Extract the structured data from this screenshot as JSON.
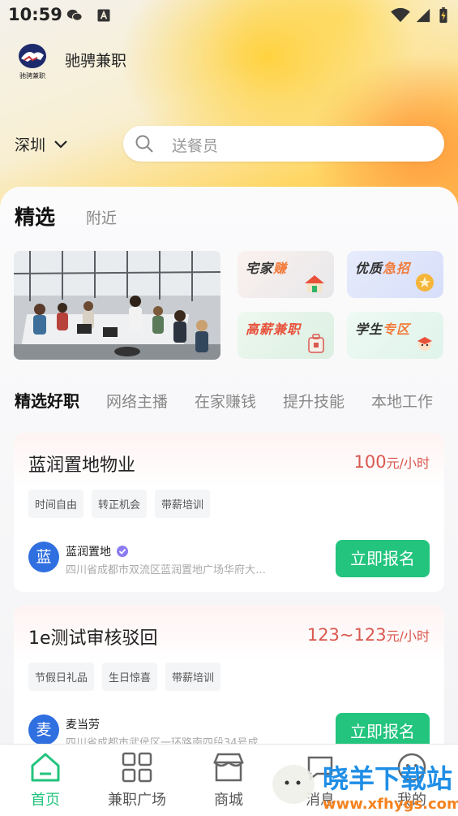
{
  "status_bar": {
    "time": "10:59"
  },
  "app": {
    "name": "驰骋兼职",
    "logo_text": "驰骋兼职"
  },
  "location": {
    "city": "深圳"
  },
  "search": {
    "placeholder": "送餐员"
  },
  "top_tabs": [
    {
      "label": "精选",
      "active": true
    },
    {
      "label": "附近",
      "active": false
    }
  ],
  "quick_tiles": [
    {
      "label_a": "宅家",
      "label_b": "赚",
      "icon": "house-icon"
    },
    {
      "label_a": "优质",
      "label_b": "急招",
      "icon": "star-coin-icon"
    },
    {
      "label_a": "高薪兼职",
      "label_b": "",
      "icon": "briefcase-icon"
    },
    {
      "label_a": "学生",
      "label_b": "专区",
      "icon": "student-icon"
    }
  ],
  "categories": [
    {
      "label": "精选好职",
      "active": true
    },
    {
      "label": "网络主播",
      "active": false
    },
    {
      "label": "在家赚钱",
      "active": false
    },
    {
      "label": "提升技能",
      "active": false
    },
    {
      "label": "本地工作",
      "active": false
    }
  ],
  "jobs": [
    {
      "title": "蓝润置地物业",
      "price": "100",
      "unit": "元/小时",
      "tags": [
        "时间自由",
        "转正机会",
        "带薪培训"
      ],
      "avatar": "蓝",
      "company": "蓝润置地",
      "address": "四川省成都市双流区蓝润置地广场华府大…",
      "apply_label": "立即报名"
    },
    {
      "title": "1e测试审核驳回",
      "price": "123~123",
      "unit": "元/小时",
      "tags": [
        "节假日礼品",
        "生日惊喜",
        "带薪培训"
      ],
      "avatar": "麦",
      "company": "麦当劳",
      "address": "四川省成都市武侯区一环路南四段34号成…",
      "apply_label": "立即报名"
    }
  ],
  "tab_bar": [
    {
      "label": "首页",
      "icon": "home-icon",
      "active": true
    },
    {
      "label": "兼职广场",
      "icon": "grid-icon",
      "active": false
    },
    {
      "label": "商城",
      "icon": "store-icon",
      "active": false
    },
    {
      "label": "消息",
      "icon": "message-icon",
      "active": false
    },
    {
      "label": "我的",
      "icon": "profile-icon",
      "active": false
    }
  ],
  "watermark": {
    "text": "晓羊下载站",
    "url": "www.xfhygs.com"
  },
  "colors": {
    "accent": "#23c47e",
    "price": "#d9584f",
    "avatar": "#2f6fe0"
  }
}
